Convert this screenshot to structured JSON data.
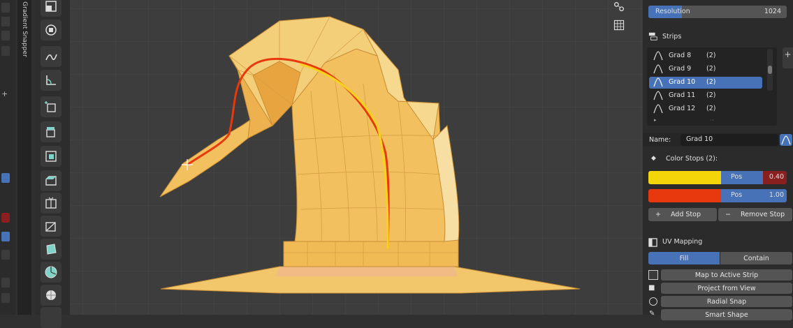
{
  "sidebar_tab": {
    "label": "Gradient Snapper"
  },
  "resolution": {
    "label": "Resolution",
    "value": "1024"
  },
  "strips": {
    "title": "Strips",
    "items": [
      {
        "name": "Grad 8",
        "count": "(2)"
      },
      {
        "name": "Grad 9",
        "count": "(2)"
      },
      {
        "name": "Grad 10",
        "count": "(2)"
      },
      {
        "name": "Grad 11",
        "count": "(2)"
      },
      {
        "name": "Grad 12",
        "count": "(2)"
      }
    ],
    "selected_index": 2
  },
  "name_field": {
    "label": "Name:",
    "value": "Grad 10"
  },
  "color_stops": {
    "title": "Color Stops (2):",
    "stops": [
      {
        "color": "#f2d60a",
        "pos_label": "Pos",
        "pos": "0.40"
      },
      {
        "color": "#e8380e",
        "pos_label": "Pos",
        "pos": "1.00"
      }
    ],
    "add_label": "Add Stop",
    "remove_label": "Remove Stop"
  },
  "uv_mapping": {
    "title": "UV Mapping",
    "modes": [
      "Fill",
      "Contain"
    ],
    "active_mode": "Fill",
    "actions": [
      "Map to Active Strip",
      "Project from View",
      "Radial Snap",
      "Smart Shape"
    ]
  },
  "colors": {
    "accent": "#4872b8",
    "mesh": "#f0b84a",
    "stroke": "#e8380e"
  }
}
